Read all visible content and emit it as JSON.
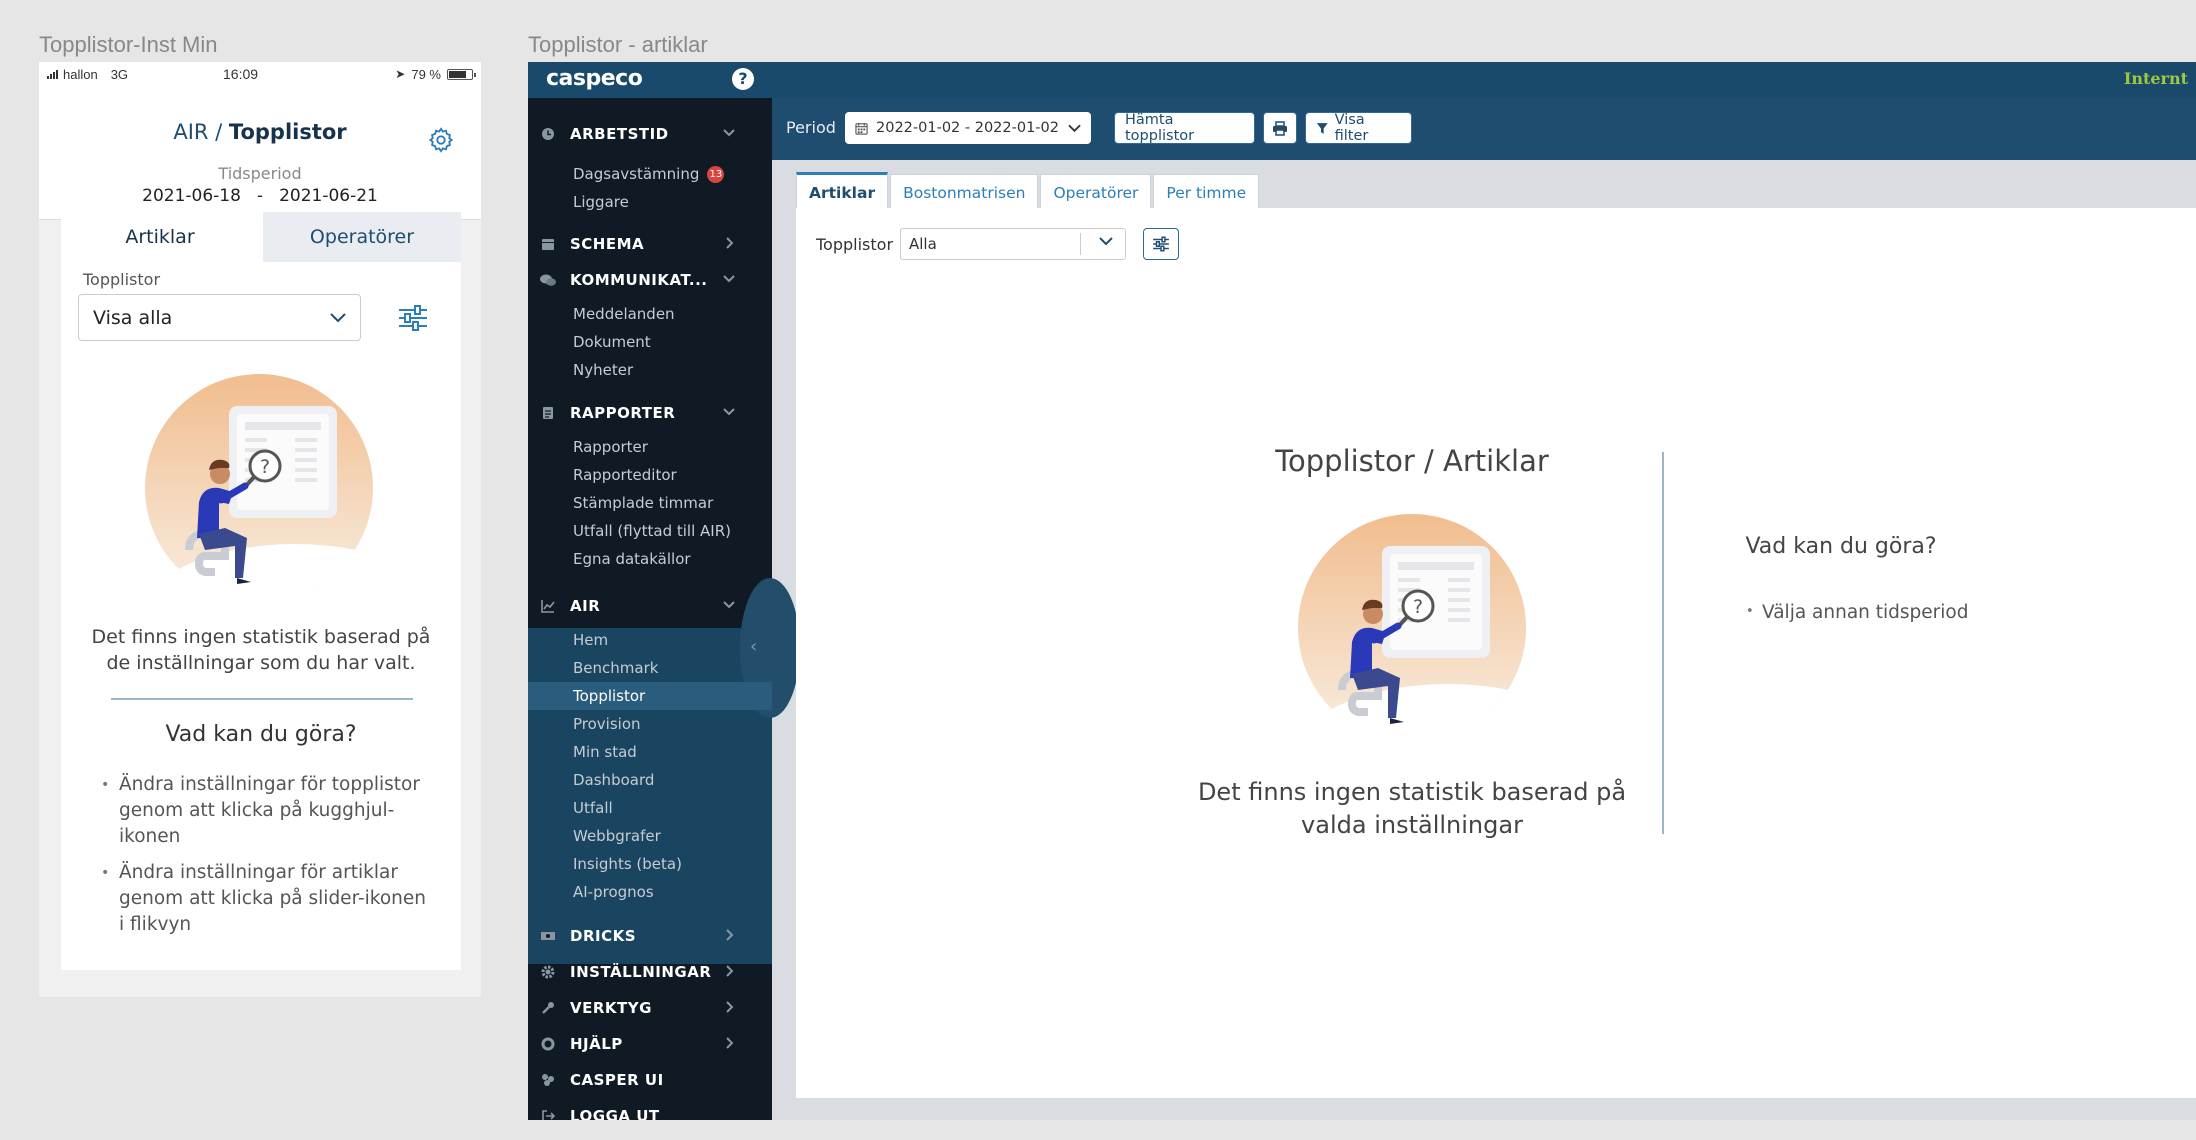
{
  "labels": {
    "mobile_frame": "Topplistor-Inst Min",
    "desktop_frame": "Topplistor - artiklar"
  },
  "mobile": {
    "status": {
      "carrier": "hallon",
      "network": "3G",
      "time": "16:09",
      "battery": "79 %",
      "battery_level": 0.79
    },
    "header": {
      "section": "AIR",
      "separator": " / ",
      "page": "Topplistor"
    },
    "period": {
      "label": "Tidsperiod",
      "from": "2021-06-18",
      "dash": "-",
      "to": "2021-06-21"
    },
    "tabs": [
      {
        "label": "Artiklar",
        "active": true
      },
      {
        "label": "Operatörer",
        "active": false
      }
    ],
    "filter": {
      "label": "Topplistor",
      "value": "Visa alla"
    },
    "empty_message": "Det finns ingen statistik baserad på de inställningar som du har valt.",
    "help_title": "Vad kan du göra?",
    "help_items": [
      "Ändra inställningar för topplistor genom att klicka på kugghjul-ikonen",
      "Ändra inställningar för artiklar genom att klicka på slider-ikonen i flikvyn"
    ]
  },
  "desktop": {
    "topbar": {
      "logo": "caspeco",
      "help": "?",
      "env": "Internt"
    },
    "sidebar": {
      "sections": [
        {
          "key": "arbetstid",
          "label": "ARBETSTID",
          "icon": "clock-icon",
          "chevron": "down"
        },
        {
          "key": "schema",
          "label": "SCHEMA",
          "icon": "calendar-icon",
          "chevron": "right"
        },
        {
          "key": "kommunikation",
          "label": "KOMMUNIKAT...",
          "icon": "chat-icon",
          "chevron": "down"
        },
        {
          "key": "rapporter",
          "label": "RAPPORTER",
          "icon": "document-icon",
          "chevron": "down"
        },
        {
          "key": "air",
          "label": "AIR",
          "icon": "chart-icon",
          "chevron": "down"
        },
        {
          "key": "dricks",
          "label": "DRICKS",
          "icon": "money-icon",
          "chevron": "right"
        },
        {
          "key": "installningar",
          "label": "INSTÄLLNINGAR",
          "icon": "gear-icon",
          "chevron": "right"
        },
        {
          "key": "verktyg",
          "label": "VERKTYG",
          "icon": "wrench-icon",
          "chevron": "right"
        },
        {
          "key": "hjalp",
          "label": "HJÄLP",
          "icon": "lifebuoy-icon",
          "chevron": "right"
        },
        {
          "key": "casperui",
          "label": "CASPER UI",
          "icon": "apps-icon",
          "chevron": ""
        },
        {
          "key": "loggaut",
          "label": "LOGGA UT",
          "icon": "logout-icon",
          "chevron": ""
        }
      ],
      "items": {
        "arbetstid": [
          {
            "label": "Dagsavstämning",
            "badge": "13"
          },
          {
            "label": "Liggare"
          }
        ],
        "kommunikation": [
          {
            "label": "Meddelanden"
          },
          {
            "label": "Dokument"
          },
          {
            "label": "Nyheter"
          }
        ],
        "rapporter": [
          {
            "label": "Rapporter"
          },
          {
            "label": "Rapporteditor"
          },
          {
            "label": "Stämplade timmar"
          },
          {
            "label": "Utfall (flyttad till AIR)"
          },
          {
            "label": "Egna datakällor"
          }
        ],
        "air": [
          {
            "label": "Hem"
          },
          {
            "label": "Benchmark"
          },
          {
            "label": "Topplistor",
            "active": true
          },
          {
            "label": "Provision"
          },
          {
            "label": "Min stad"
          },
          {
            "label": "Dashboard"
          },
          {
            "label": "Utfall"
          },
          {
            "label": "Webbgrafer"
          },
          {
            "label": "Insights (beta)"
          },
          {
            "label": "AI-prognos"
          }
        ]
      }
    },
    "toolbar": {
      "period_label": "Period",
      "date_range": "2022-01-02 - 2022-01-02",
      "fetch_button": "Hämta topplistor",
      "filter_button": "Visa filter"
    },
    "tabs": [
      {
        "label": "Artiklar",
        "active": true
      },
      {
        "label": "Bostonmatrisen"
      },
      {
        "label": "Operatörer"
      },
      {
        "label": "Per timme"
      }
    ],
    "filter": {
      "label": "Topplistor",
      "value": "Alla"
    },
    "content": {
      "title": "Topplistor / Artiklar",
      "empty_message": "Det finns ingen statistik baserad på valda inställningar",
      "help_title": "Vad kan du göra?",
      "help_items": [
        "Välja annan tidsperiod"
      ]
    },
    "colors": {
      "navy": "#1f4d6f",
      "sidebar": "#0f1a24",
      "accent": "#2c7fb6",
      "env": "#9ccc3c",
      "badge": "#d9463e"
    }
  }
}
